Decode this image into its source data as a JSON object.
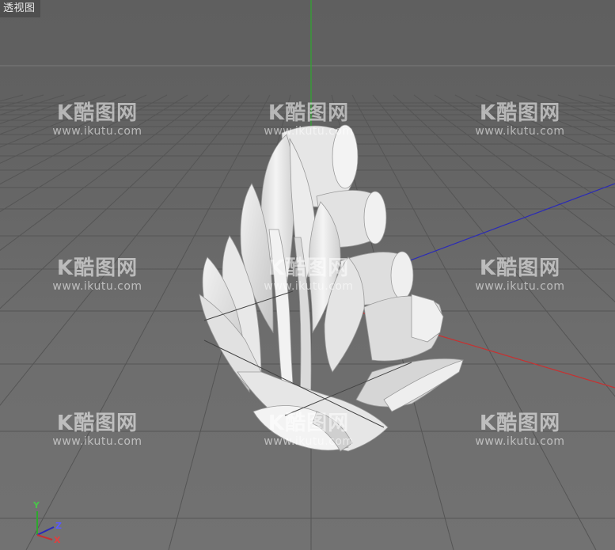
{
  "viewport": {
    "label": "透视图",
    "background": "#666666"
  },
  "axes": {
    "x_axis_color": "#c83030",
    "y_axis_color": "#2ea82e",
    "z_axis_color": "#2a2ab8",
    "gizmo": {
      "y_label": "Y",
      "z_label": "Z",
      "x_label": "X"
    }
  },
  "model": {
    "icon": "carved-leaf-ornament-3d-model",
    "color": "#e9e9e9"
  },
  "watermark": {
    "logo_text": "K酷图网",
    "url_text": "www.ikutu.com",
    "count": 9
  }
}
